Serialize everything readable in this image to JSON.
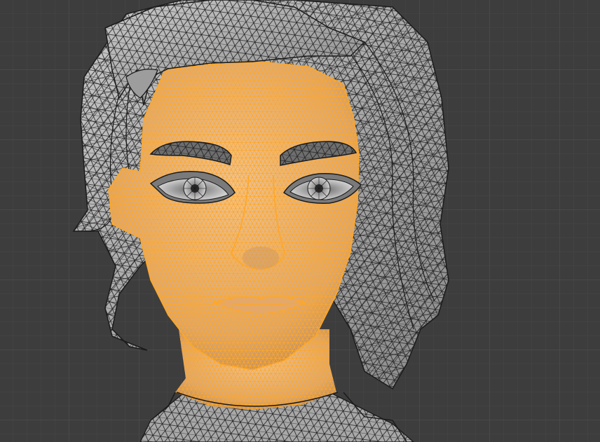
{
  "viewport": {
    "background": "#3d3d3d",
    "grid_minor_color": "#474747",
    "grid_major_color": "#505050",
    "selection_color": "#ffa726",
    "mesh_face_color": "#b8b8b8",
    "mesh_edge_color": "#1a1a1a",
    "selected_face_color": "#e8b077"
  }
}
